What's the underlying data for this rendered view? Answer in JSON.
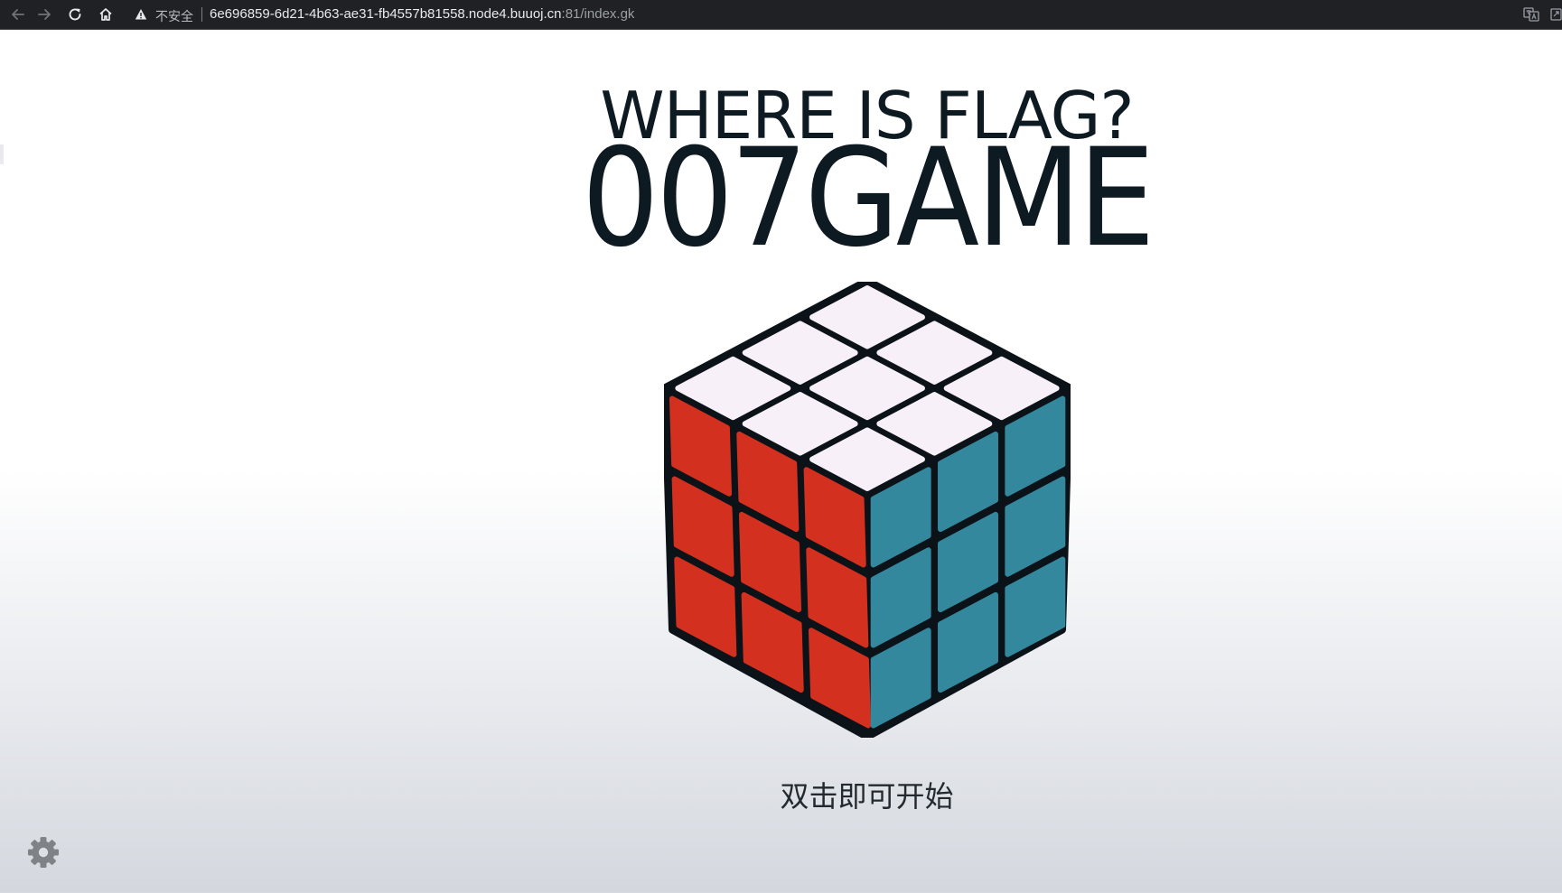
{
  "browser": {
    "security_label": "不安全",
    "url_host": "6e696859-6d21-4b63-ae31-fb4557b81558.node4.buuoj.cn",
    "url_rest": ":81/index.gk",
    "icons": {
      "back": "arrow-left-icon",
      "forward": "arrow-right-icon",
      "reload": "reload-icon",
      "home": "home-icon",
      "warning": "warning-icon",
      "translate": "translate-icon"
    }
  },
  "page": {
    "subtitle": "WHERE IS FLAG?",
    "title": "007GAME",
    "start_hint": "双击即可开始",
    "settings_icon": "gear-icon",
    "cube": {
      "top_color": "#f7f0f8",
      "left_color": "#d3301f",
      "right_color": "#33889d",
      "body_color": "#0b1218"
    }
  }
}
